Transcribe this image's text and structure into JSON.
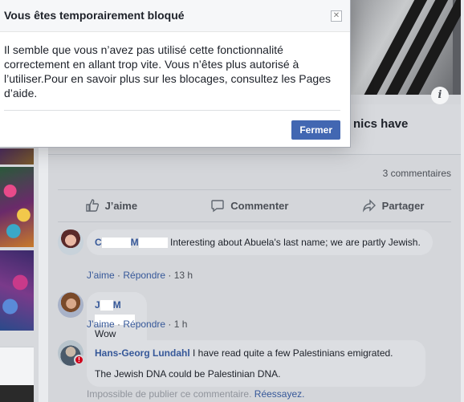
{
  "dialog": {
    "title": "Vous êtes temporairement bloqué",
    "close_icon": "close-icon",
    "message": "Il semble que vous n’avez pas utilisé cette fonctionnalité correctement en allant trop vite. Vous n’êtes plus autorisé à l’utiliser.Pour en savoir plus sur les blocages, consultez les Pages d’aide.",
    "close_button": "Fermer",
    "accent_color": "#4267b2"
  },
  "post": {
    "title_fragment": "nics have",
    "comments_count": "3 commentaires",
    "actions": {
      "like": "J’aime",
      "comment": "Commenter",
      "share": "Partager"
    }
  },
  "comments": [
    {
      "author_visible": "C",
      "author_part2": "M",
      "text": "Interesting about Abuela's last name; we are partly Jewish.",
      "like": "J’aime",
      "reply": "Répondre",
      "time": "13 h"
    },
    {
      "author_visible": "J",
      "author_part2": "M",
      "text": "Wow interesting",
      "like": "J’aime",
      "reply": "Répondre",
      "time": "1 h"
    },
    {
      "author_visible": "Hans-Georg Lundahl",
      "text_line1": "I have read quite a few Palestinians emigrated.",
      "text_line2": "The Jewish DNA could be Palestinian DNA.",
      "error_text": "Impossible de publier ce commentaire.",
      "retry": "Réessayez."
    }
  ]
}
